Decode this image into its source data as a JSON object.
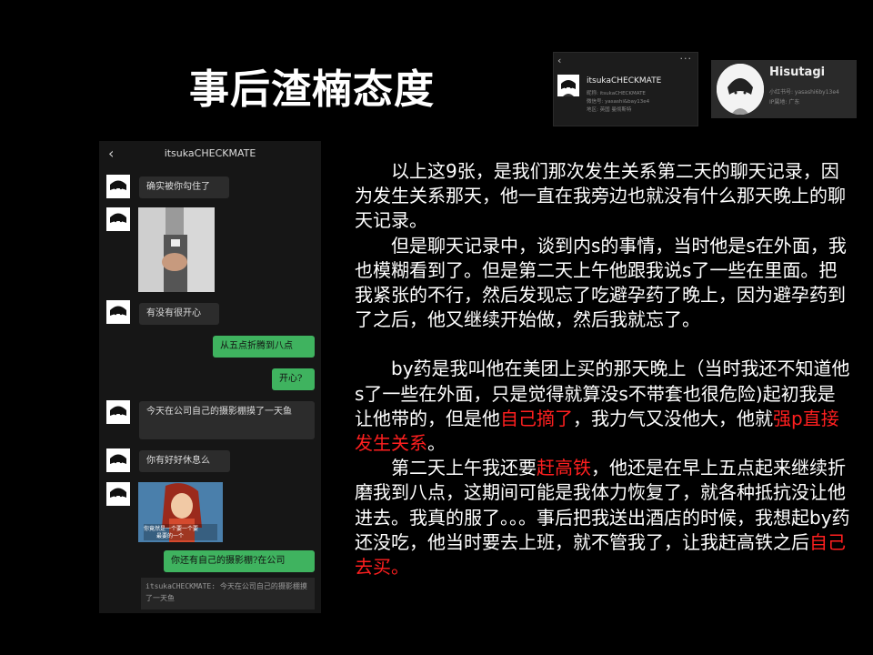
{
  "slide": {
    "title": "事后渣楠态度"
  },
  "profile_left": {
    "back_icon": "chevron-left-icon",
    "more_icon": "more-dots-icon",
    "name": "itsukaCHECKMATE",
    "nickname_line": "昵称: itsukaCHECKMATE",
    "wechat_line": "微信号: yasashi&bay13e4",
    "region_line": "地区: 英国 曼彻斯特"
  },
  "profile_right": {
    "name": "Hisutagi",
    "id_line": "小红书号: yasashi6by13e4",
    "ip_line": "IP属地: 广东"
  },
  "chat": {
    "title": "itsukaCHECKMATE",
    "back_glyph": "‹",
    "messages": [
      {
        "side": "in",
        "text": "确实被你勾住了"
      },
      {
        "side": "in",
        "text": "有没有很开心"
      },
      {
        "side": "out",
        "text": "从五点折腾到八点"
      },
      {
        "side": "out",
        "text": "开心?"
      },
      {
        "side": "in",
        "text": "今天在公司自己的摄影棚摸了一天鱼"
      },
      {
        "side": "in",
        "text": "你有好好休息么"
      },
      {
        "side": "out",
        "text": "你还有自己的摄影棚?在公司"
      }
    ],
    "photo_caption_1": "你竟然是一个要一个要",
    "photo_caption_2": "最要的一个",
    "quote": "itsukaCHECKMATE: 今天在公司自己的摄影棚摸了一天鱼"
  },
  "body": {
    "p1": "以上这9张，是我们那次发生关系第二天的聊天记录，因为发生关系那天，他一直在我旁边也就没有什么那天晚上的聊天记录。",
    "p2": "但是聊天记录中，谈到内s的事情，当时他是s在外面，我也模糊看到了。但是第二天上午他跟我说s了一些在里面。把我紧张的不行，然后发现忘了吃避孕药了晚上，因为避孕药到了之后，他又继续开始做，然后我就忘了。",
    "p3_a": "by药是我叫他在美团上买的那天晚上（当时我还不知道他s了一些在外面，只是觉得就算没s不带套也很危险)起初我是让他带的，但是他",
    "p3_red1": "自己摘了",
    "p3_b": "，我力气又没他大，他就",
    "p3_red2": "强p直接发生关系",
    "p3_c": "。",
    "p4_a": "第二天上午我还要",
    "p4_red1": "赶高铁",
    "p4_b": "，他还是在早上五点起来继续折磨我到八点，这期间可能是我体力恢复了，就各种抵抗没让他进去。我真的服了。。。事后把我送出酒店的时候，我想起by药还没吃，他当时要去上班，就不管我了，让我赶高铁之后",
    "p4_red2": "自己去买。"
  },
  "colors": {
    "background": "#000000",
    "highlight_red": "#ff1f1f",
    "bubble_green": "#3fb35f",
    "bubble_dark": "#2c2c2c"
  }
}
